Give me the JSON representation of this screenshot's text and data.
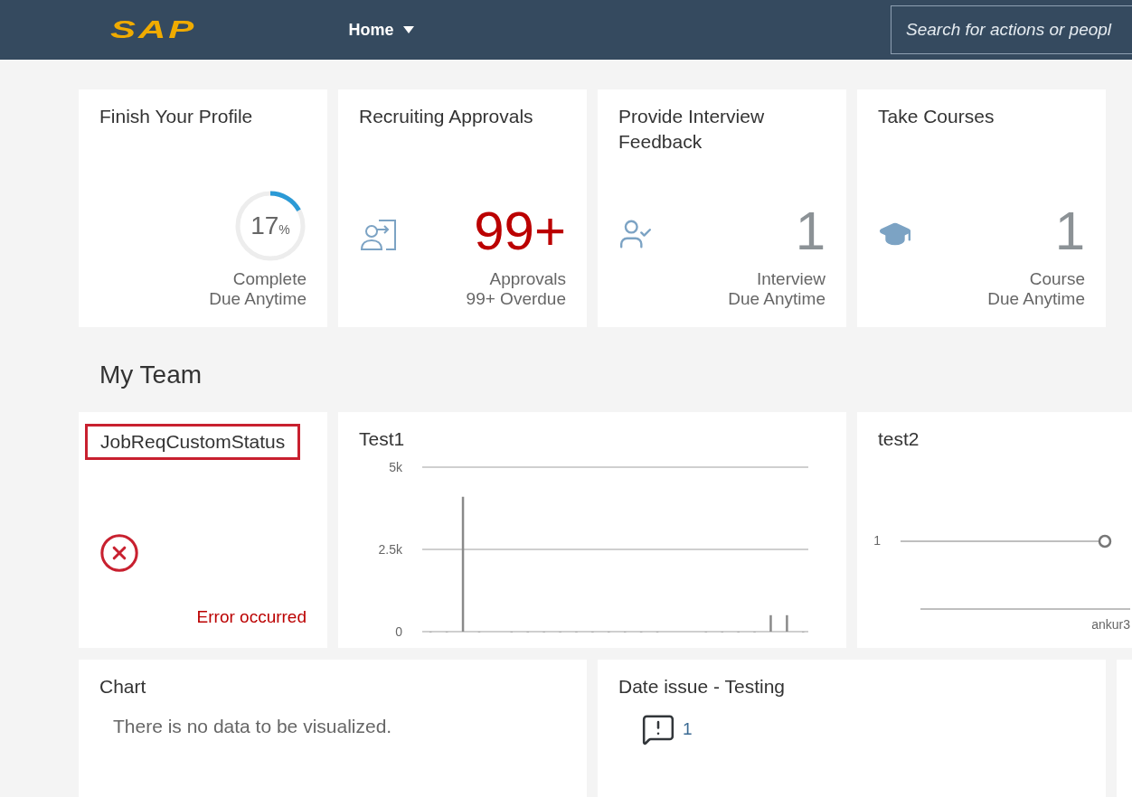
{
  "header": {
    "logo": "SAP",
    "menu": {
      "label": "Home"
    },
    "search": {
      "placeholder": "Search for actions or peopl"
    }
  },
  "top_tiles": [
    {
      "kind": "progress",
      "title": "Finish Your Profile",
      "level": 0.17,
      "value": "17",
      "unit": "%",
      "subtitle": "Complete",
      "footer": "Due Anytime"
    },
    {
      "kind": "count",
      "title": "Recruiting Approvals",
      "value": "99+",
      "color": "#bb0000",
      "subtitle": "Approvals",
      "footer": "99+ Overdue"
    },
    {
      "kind": "count",
      "title": "Provide Interview Feedback",
      "value": "1",
      "color": "#8c9296",
      "subtitle": "Interview",
      "footer": "Due Anytime"
    },
    {
      "kind": "count",
      "title": "Take Courses",
      "value": "1",
      "color": "#8c9296",
      "subtitle": "Course",
      "footer": "Due Anytime"
    }
  ],
  "section_title": "My Team",
  "team_tiles": [
    {
      "kind": "error",
      "title": "JobReqCustomStatus",
      "highlighted": true,
      "message": "Error occurred"
    },
    {
      "kind": "chart",
      "title": "Test1",
      "chart_data": {
        "type": "bar",
        "values": [
          0,
          0,
          4100,
          0,
          null,
          0,
          0,
          0,
          0,
          0,
          0,
          0,
          0,
          0,
          0,
          null,
          null,
          0,
          0,
          0,
          0,
          500,
          500,
          0
        ],
        "ylim": [
          0,
          5000
        ],
        "yticks": [
          {
            "value": 0,
            "label": "0"
          },
          {
            "value": 2500,
            "label": "2.5k"
          },
          {
            "value": 5000,
            "label": "5k"
          }
        ]
      }
    },
    {
      "kind": "sparkline",
      "title": "test2",
      "y_label": "1",
      "x_label": "ankur3"
    }
  ],
  "bottom_tiles": [
    {
      "kind": "empty",
      "title": "Chart",
      "message": "There is no data to be visualized."
    },
    {
      "kind": "notice",
      "title": "Date issue - Testing",
      "count": "1"
    }
  ]
}
